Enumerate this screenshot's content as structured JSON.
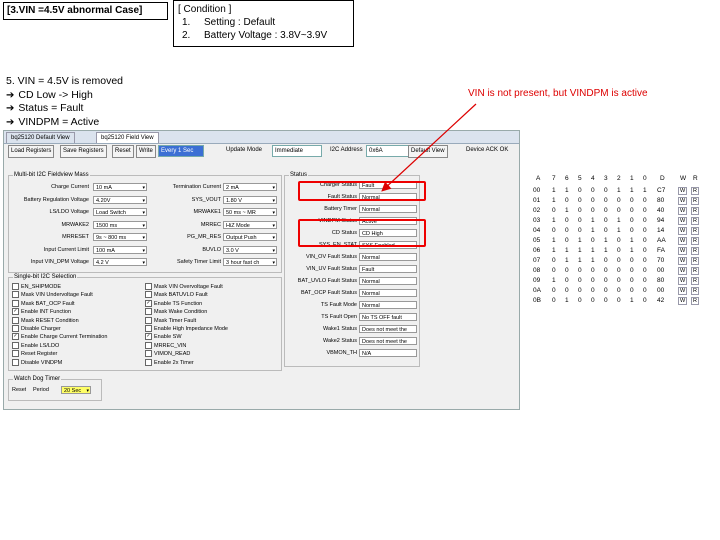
{
  "case_title": "[3.VIN =4.5V abnormal Case]",
  "condition": {
    "title": "[ Condition ]",
    "items": [
      {
        "num": "1.",
        "text": "Setting : Default"
      },
      {
        "num": "2.",
        "text": "Battery Voltage : 3.8V~3.9V"
      }
    ]
  },
  "steps": {
    "intro": "5. VIN = 4.5V is removed",
    "bullets": [
      "CD Low -> High",
      "Status = Fault",
      "VINDPM = Active"
    ],
    "arrow_icon": "➔"
  },
  "note": "VIN is not present, but VINDPM is active",
  "app": {
    "tabs": [
      "bq25120 Default View",
      "bq25120 Field View"
    ],
    "toolbar": {
      "load_registers": "Load Registers",
      "save_registers": "Save Registers",
      "reset": "Reset",
      "write": "Write",
      "every_sec": "Every 1 Sec",
      "update_mode_label": "Update Mode",
      "update_mode_value": "Immediate",
      "i2c_label": "I2C Address",
      "i2c_value": "0x6A",
      "default_view": "Default View",
      "device_ack": "Device ACK OK"
    },
    "multibit": {
      "title": "Multi-bit I2C Fieldview Mass",
      "left": [
        {
          "label": "Charge Current",
          "value": "10 mA"
        },
        {
          "label": "Battery Regulation Voltage",
          "value": "4.20V"
        },
        {
          "label": "LS/LDO Voltage",
          "value": "Load Switch"
        },
        {
          "label": "MRWAKE2",
          "value": "1500 ms"
        },
        {
          "label": "MRRESET",
          "value": "9s ~ 800 ms"
        },
        {
          "label": "Input Current Limit",
          "value": "100 mA"
        },
        {
          "label": "Input VIN_DPM Voltage",
          "value": "4.2 V"
        }
      ],
      "right": [
        {
          "label": "Termination Current",
          "value": "2 mA"
        },
        {
          "label": "SYS_VOUT",
          "value": "1.80 V"
        },
        {
          "label": "MRWAKE1",
          "value": "50 ms ~ MR"
        },
        {
          "label": "MRREC",
          "value": "HiZ Mode"
        },
        {
          "label": "PG_MR_RES",
          "value": "Output Push"
        },
        {
          "label": "BUVLO",
          "value": "3.0 V"
        },
        {
          "label": "Safety Timer Limit",
          "value": "3 hour fast ch"
        }
      ]
    },
    "single": {
      "title": "Single-bit I2C Selection",
      "left": [
        {
          "label": "EN_SHIPMODE",
          "checked": false
        },
        {
          "label": "Mask VIN Undervoltage Fault",
          "checked": false
        },
        {
          "label": "Mask BAT_OCP Fault",
          "checked": false
        },
        {
          "label": "Enable INT Function",
          "checked": true
        },
        {
          "label": "Mask RESET Condition",
          "checked": false
        },
        {
          "label": "Disable Charger",
          "checked": false
        },
        {
          "label": "Enable Charge Current Termination",
          "checked": true
        },
        {
          "label": "Enable LS/LDO",
          "checked": false
        },
        {
          "label": "Reset Register",
          "checked": false
        },
        {
          "label": "Disable VINDPM",
          "checked": false
        }
      ],
      "right": [
        {
          "label": "Mask VIN Overvoltage Fault",
          "checked": false
        },
        {
          "label": "Mask BATUVLO Fault",
          "checked": false
        },
        {
          "label": "Enable TS Function",
          "checked": true
        },
        {
          "label": "Mask Wake Condition",
          "checked": false
        },
        {
          "label": "Mask Timer Fault",
          "checked": false
        },
        {
          "label": "Enable High Impedance Mode",
          "checked": false
        },
        {
          "label": "Enable SW",
          "checked": true
        },
        {
          "label": "MRREC_VIN",
          "checked": false
        },
        {
          "label": "VIMON_READ",
          "checked": false
        },
        {
          "label": "Enable 2x Timer",
          "checked": false
        }
      ]
    },
    "watchdog": {
      "title": "Watch Dog Timer",
      "reset_label": "Reset",
      "period_label": "Period",
      "period_value": "20 Sec"
    },
    "status": {
      "title": "Status",
      "rows": [
        {
          "label": "Charger Status",
          "value": "Fault"
        },
        {
          "label": "Fault Status",
          "value": "Normal"
        },
        {
          "label": "Battery Timer",
          "value": "Normal"
        },
        {
          "label": "VINDPM Status",
          "value": "Active"
        },
        {
          "label": "CD Status",
          "value": "CD High"
        },
        {
          "label": "SYS_EN_STAT",
          "value": "SYS Enabled"
        },
        {
          "label": "VIN_OV Fault Status",
          "value": "Normal"
        },
        {
          "label": "VIN_UV Fault Status",
          "value": "Fault"
        },
        {
          "label": "BAT_UVLO Fault Status",
          "value": "Normal"
        },
        {
          "label": "BAT_OCP Fault Status",
          "value": "Normal"
        },
        {
          "label": "TS Fault Mode",
          "value": "Normal"
        },
        {
          "label": "TS Fault Open",
          "value": "No TS OFF fault"
        },
        {
          "label": "Wake1 Status",
          "value": "Does not meet the"
        },
        {
          "label": "Wake2 Status",
          "value": "Does not meet the"
        },
        {
          "label": "VBMON_TH",
          "value": "N/A"
        }
      ]
    },
    "register_grid": {
      "headers": [
        "A",
        "7",
        "6",
        "5",
        "4",
        "3",
        "2",
        "1",
        "0",
        "D",
        "W",
        "R"
      ],
      "rows": [
        {
          "addr": "00",
          "bits": [
            "1",
            "1",
            "0",
            "0",
            "0",
            "1",
            "1",
            "1"
          ],
          "val": "C7"
        },
        {
          "addr": "01",
          "bits": [
            "1",
            "0",
            "0",
            "0",
            "0",
            "0",
            "0",
            "0"
          ],
          "val": "80"
        },
        {
          "addr": "02",
          "bits": [
            "0",
            "1",
            "0",
            "0",
            "0",
            "0",
            "0",
            "0"
          ],
          "val": "40"
        },
        {
          "addr": "03",
          "bits": [
            "1",
            "0",
            "0",
            "1",
            "0",
            "1",
            "0",
            "0"
          ],
          "val": "94"
        },
        {
          "addr": "04",
          "bits": [
            "0",
            "0",
            "0",
            "1",
            "0",
            "1",
            "0",
            "0"
          ],
          "val": "14"
        },
        {
          "addr": "05",
          "bits": [
            "1",
            "0",
            "1",
            "0",
            "1",
            "0",
            "1",
            "0"
          ],
          "val": "AA"
        },
        {
          "addr": "06",
          "bits": [
            "1",
            "1",
            "1",
            "1",
            "1",
            "0",
            "1",
            "0"
          ],
          "val": "FA"
        },
        {
          "addr": "07",
          "bits": [
            "0",
            "1",
            "1",
            "1",
            "0",
            "0",
            "0",
            "0"
          ],
          "val": "70"
        },
        {
          "addr": "08",
          "bits": [
            "0",
            "0",
            "0",
            "0",
            "0",
            "0",
            "0",
            "0"
          ],
          "val": "00"
        },
        {
          "addr": "09",
          "bits": [
            "1",
            "0",
            "0",
            "0",
            "0",
            "0",
            "0",
            "0"
          ],
          "val": "80"
        },
        {
          "addr": "0A",
          "bits": [
            "0",
            "0",
            "0",
            "0",
            "0",
            "0",
            "0",
            "0"
          ],
          "val": "00"
        },
        {
          "addr": "0B",
          "bits": [
            "0",
            "1",
            "0",
            "0",
            "0",
            "0",
            "1",
            "0"
          ],
          "val": "42"
        }
      ],
      "w_label": "W",
      "r_label": "R"
    }
  },
  "colors": {
    "highlight": "#e00000",
    "note": "#dd0000"
  }
}
